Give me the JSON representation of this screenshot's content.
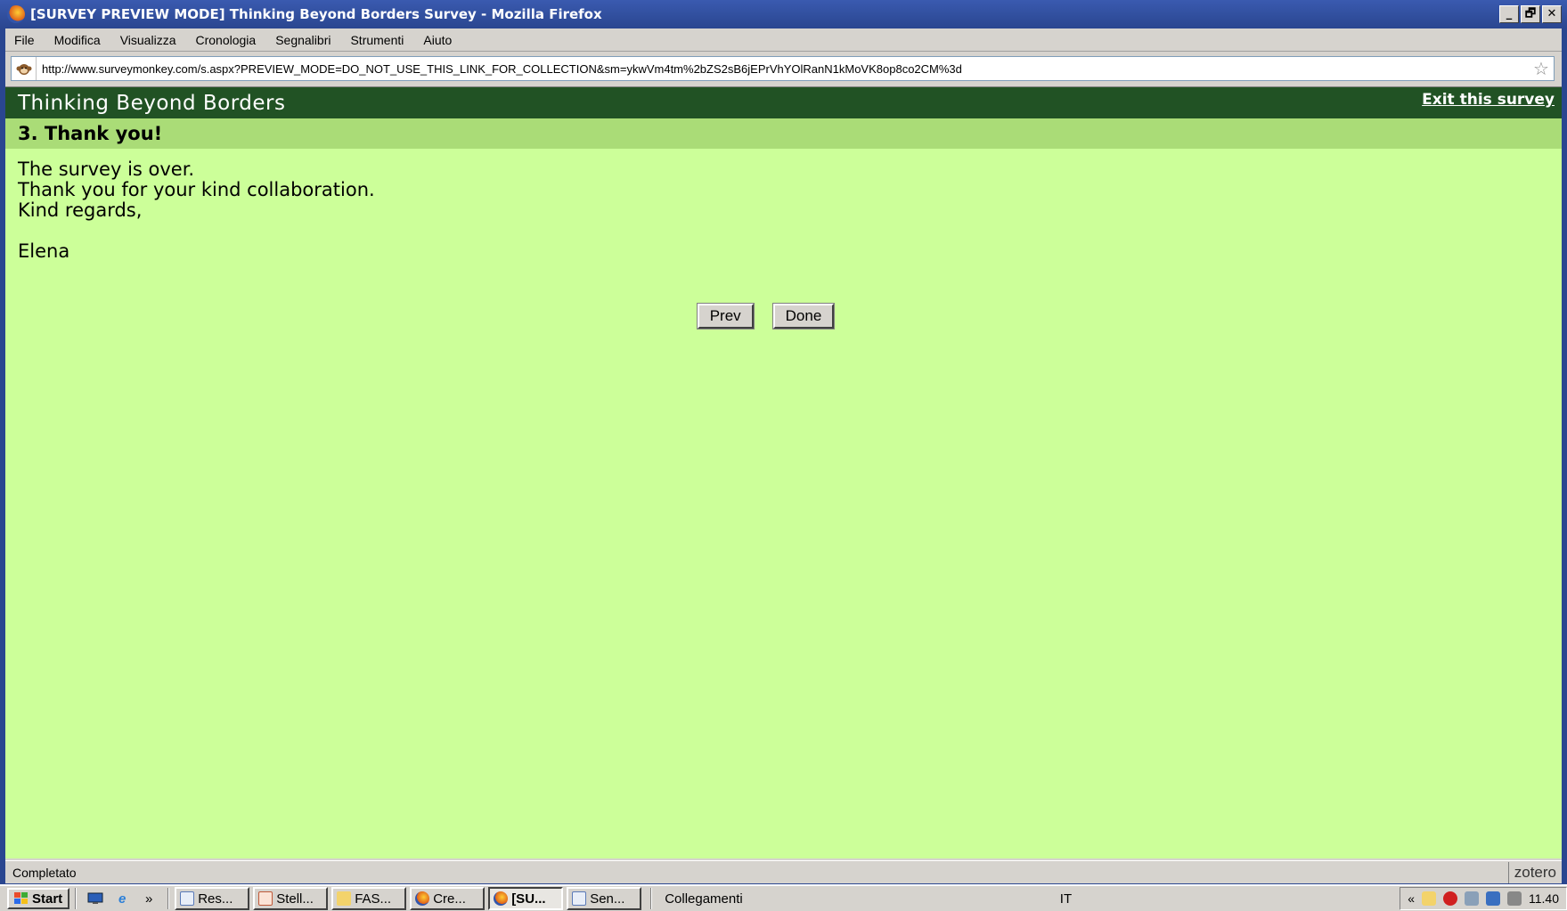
{
  "window": {
    "title": "[SURVEY PREVIEW MODE] Thinking Beyond Borders Survey - Mozilla Firefox",
    "buttons": [
      "_",
      "🗗",
      "✕"
    ]
  },
  "menu": {
    "items": [
      "File",
      "Modifica",
      "Visualizza",
      "Cronologia",
      "Segnalibri",
      "Strumenti",
      "Aiuto"
    ]
  },
  "address_bar": {
    "url": "http://www.surveymonkey.com/s.aspx?PREVIEW_MODE=DO_NOT_USE_THIS_LINK_FOR_COLLECTION&sm=ykwVm4tm%2bZS2sB6jEPrVhYOlRanN1kMoVK8op8co2CM%3d"
  },
  "survey": {
    "title": "Thinking Beyond Borders",
    "exit_link": "Exit this survey",
    "page_heading": "3. Thank you!",
    "message_lines": [
      "The survey is over.",
      "Thank you for your kind collaboration.",
      "Kind regards,",
      "",
      "Elena"
    ],
    "prev_label": "Prev",
    "done_label": "Done"
  },
  "status_bar": {
    "text": "Completato",
    "addon": "zotero"
  },
  "taskbar": {
    "start_label": "Start",
    "quicklaunch_more": "»",
    "tasks": [
      {
        "label": "Res...",
        "icon": "document-icon",
        "active": false
      },
      {
        "label": "Stell...",
        "icon": "document-icon",
        "active": false
      },
      {
        "label": "FAS...",
        "icon": "folder-icon",
        "active": false
      },
      {
        "label": "Cre...",
        "icon": "firefox-icon",
        "active": false
      },
      {
        "label": "[SU...",
        "icon": "firefox-icon",
        "active": true
      },
      {
        "label": "Sen...",
        "icon": "document-icon",
        "active": false
      }
    ],
    "links_label": "Collegamenti",
    "language": "IT",
    "tray_expand": "«",
    "clock": "11.40"
  },
  "colors": {
    "survey_header_bg": "#215224",
    "page_heading_bg": "#aadc77",
    "content_bg": "#ccff99"
  }
}
